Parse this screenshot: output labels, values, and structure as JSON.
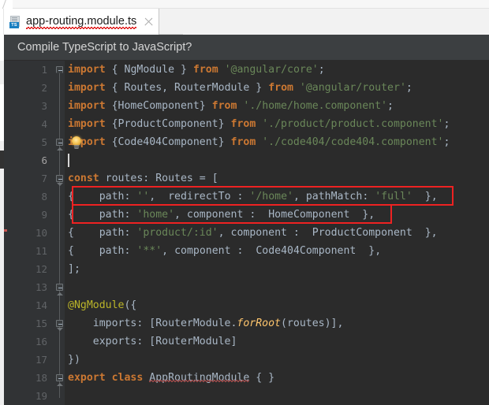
{
  "window": {
    "tab": {
      "icon": "typescript-file-icon",
      "icon_label": "TS",
      "title": "app-routing.module.ts",
      "close_label": "×",
      "has_error_underline": true
    }
  },
  "notification": {
    "message": "Compile TypeScript to JavaScript?"
  },
  "editor": {
    "caret_line": 6,
    "intention_icon": "lightbulb-icon",
    "line_numbers": [
      "1",
      "2",
      "3",
      "4",
      "5",
      "6",
      "7",
      "8",
      "9",
      "10",
      "11",
      "12",
      "13",
      "14",
      "15",
      "16",
      "17",
      "18",
      "19"
    ],
    "lines": [
      {
        "n": "1",
        "text": "import { NgModule } from '@angular/core';"
      },
      {
        "n": "2",
        "text": "import { Routes, RouterModule } from '@angular/router';"
      },
      {
        "n": "3",
        "text": "import {HomeComponent} from './home/home.component';"
      },
      {
        "n": "4",
        "text": "import {ProductComponent} from './product/product.component';"
      },
      {
        "n": "5",
        "text": "import {Code404Component} from './code404/code404.component';"
      },
      {
        "n": "6",
        "text": ""
      },
      {
        "n": "7",
        "text": "const routes: Routes = ["
      },
      {
        "n": "8",
        "text": "{    path: '',  redirectTo : '/home', pathMatch: 'full'  },"
      },
      {
        "n": "9",
        "text": "{    path: 'home', component :  HomeComponent  },"
      },
      {
        "n": "10",
        "text": "{    path: 'product/:id', component :  ProductComponent  },"
      },
      {
        "n": "11",
        "text": "{    path: '**', component :  Code404Component  },"
      },
      {
        "n": "12",
        "text": "];"
      },
      {
        "n": "13",
        "text": ""
      },
      {
        "n": "14",
        "text": "@NgModule({"
      },
      {
        "n": "15",
        "text": "imports: [RouterModule.forRoot(routes],"
      },
      {
        "n": "16",
        "text": "exports: [RouterModule]"
      },
      {
        "n": "17",
        "text": "})"
      },
      {
        "n": "18",
        "text": "export class AppRoutingModule { }"
      },
      {
        "n": "19",
        "text": ""
      }
    ],
    "annotations": [
      {
        "name": "redirect-route-highlight",
        "line": 8,
        "color": "#ee2222"
      },
      {
        "name": "home-route-highlight",
        "line": 9,
        "color": "#ee2222"
      }
    ],
    "colors": {
      "background": "#2b2b2b",
      "gutter": "#313335",
      "keyword": "#cc7832",
      "string": "#6a8759",
      "identifier": "#a9b7c6",
      "annotation": "#bbb529",
      "function": "#ffc66d",
      "line_number": "#606366",
      "highlight_box": "#ee2222"
    }
  },
  "tokens": {
    "import": "import",
    "from": "from",
    "const": "const",
    "export": "export",
    "class": "class",
    "ngmodule_decorator": "@NgModule",
    "ng_module": "NgModule",
    "routes_type": "Routes",
    "router_module": "RouterModule",
    "home_component": "HomeComponent",
    "product_component": "ProductComponent",
    "code404_component": "Code404Component",
    "app_routing_module": "AppRoutingModule",
    "for_root": "forRoot",
    "routes_var": "routes",
    "path_key": "path:",
    "component_key": "component",
    "redirect_key": "redirectTo",
    "pathmatch_key": "pathMatch:",
    "imports_key": "imports:",
    "exports_key": "exports:",
    "angular_core": "'@angular/core'",
    "angular_router": "'@angular/router'",
    "home_path": "'./home/home.component'",
    "product_path": "'./product/product.component'",
    "code404_path": "'./code404/code404.component'",
    "empty_str": "''",
    "home_str": "'/home'",
    "home_route": "'home'",
    "full_str": "'full'",
    "product_route": "'product/:id'",
    "wildcard": "'**'"
  }
}
